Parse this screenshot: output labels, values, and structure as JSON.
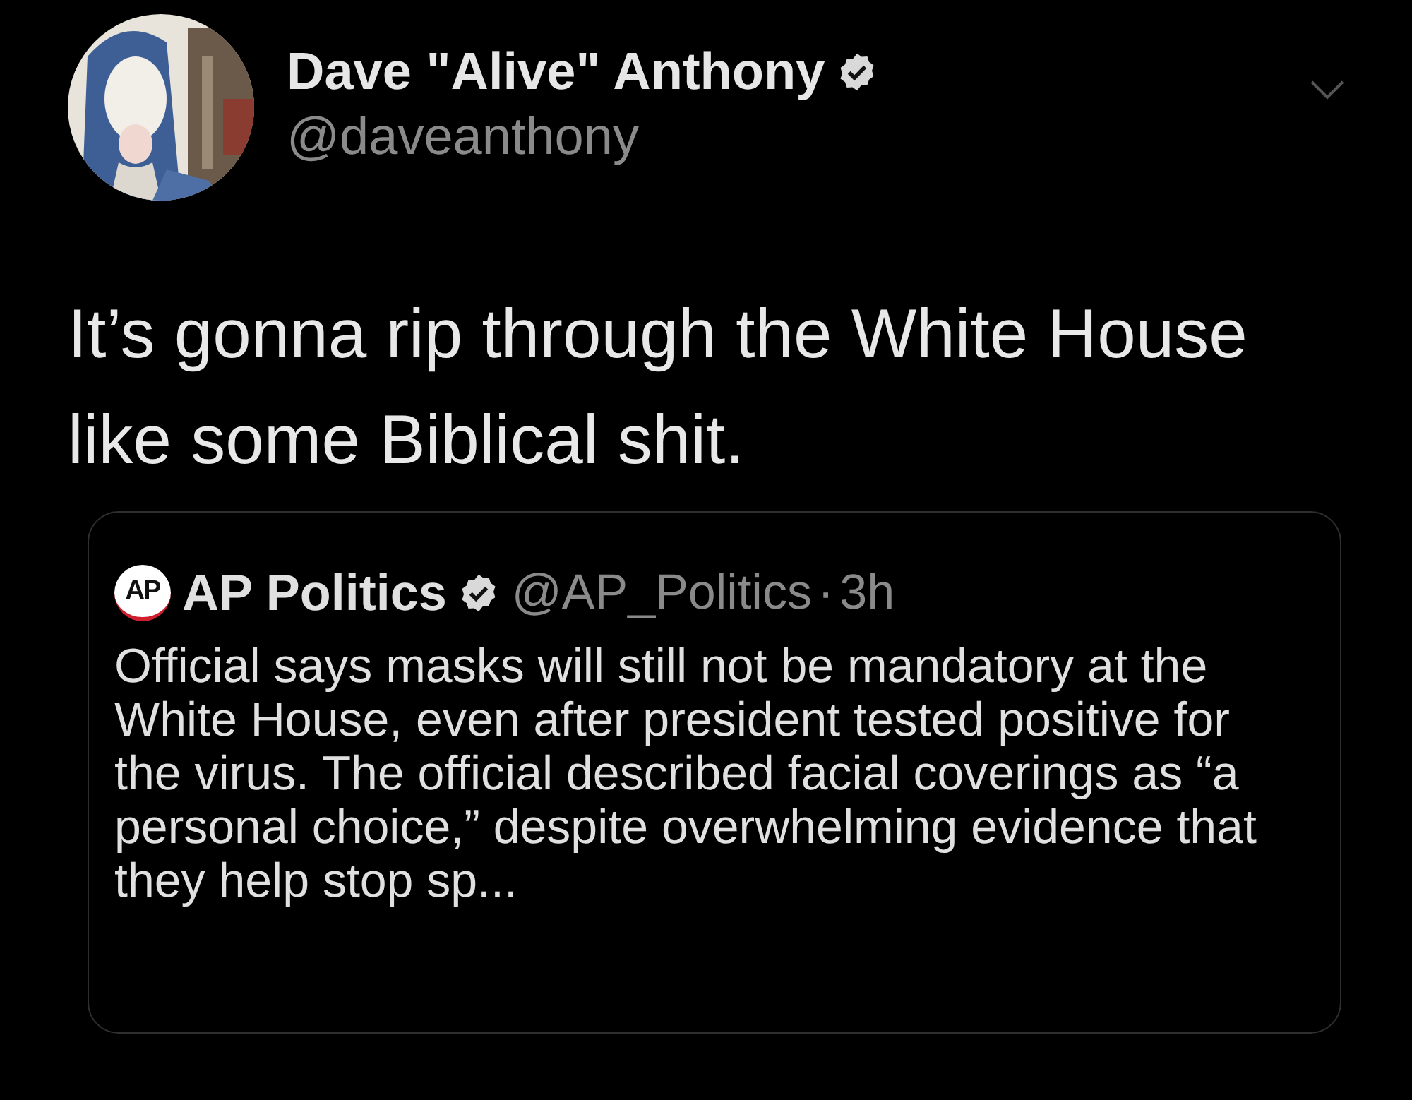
{
  "tweet": {
    "author": {
      "name": "Dave \"Alive\" Anthony",
      "handle": "@daveanthony",
      "verified": true
    },
    "text": "It’s gonna rip through the White House like some Biblical shit.",
    "quoted_tweet": {
      "logo_text": "AP",
      "name": "AP Politics",
      "verified": true,
      "handle": "@AP_Politics",
      "separator": "·",
      "time": "3h",
      "text": "Official says masks will still not be mandatory at the White House, even after president tested positive for the virus. The official described facial coverings as “a personal choice,” despite overwhelming evidence that they help stop sp..."
    }
  }
}
